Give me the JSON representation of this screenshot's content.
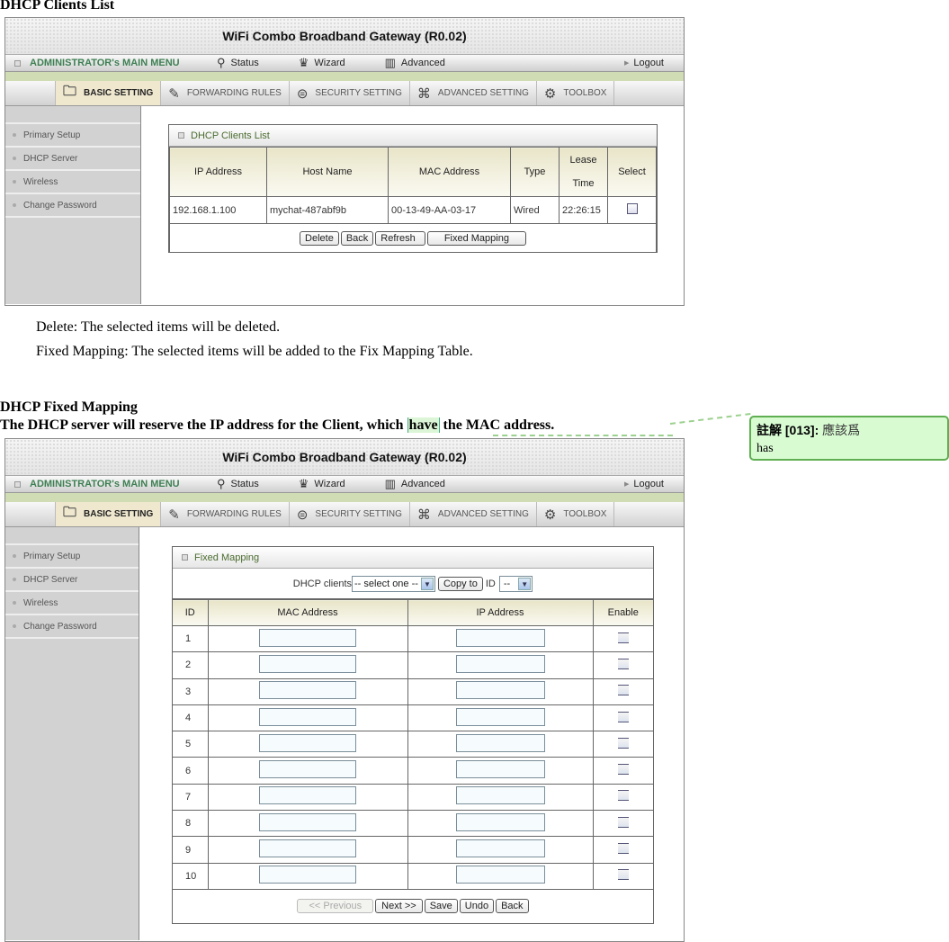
{
  "doc": {
    "heading1": "DHCP Clients List",
    "note_delete": "Delete: The selected items will be deleted.",
    "note_fixed": "Fixed Mapping: The selected items will be added to the Fix Mapping Table.",
    "heading2": "DHCP Fixed Mapping",
    "sentence_pre": "The DHCP server will reserve the IP address for the Client, which ",
    "sentence_highlight": "have",
    "sentence_post": " the MAC address."
  },
  "comment": {
    "label": "註解 [013]:",
    "suggestion_cjk": "應該爲",
    "body": "has",
    "border_color": "#5fae52",
    "bg_color": "#d8fbd2"
  },
  "router": {
    "title": "WiFi Combo Broadband Gateway (R0.02)",
    "admin_menu": "ADMINISTRATOR's MAIN MENU",
    "menu": [
      {
        "label": "Status",
        "icon": "status-icon",
        "glyph": "⚲"
      },
      {
        "label": "Wizard",
        "icon": "wizard-icon",
        "glyph": "♛"
      },
      {
        "label": "Advanced",
        "icon": "advanced-icon",
        "glyph": "▥"
      }
    ],
    "logout": "Logout",
    "tabs": [
      {
        "label": "BASIC SETTING",
        "icon": "folder-icon",
        "glyph": "🗀",
        "active": true
      },
      {
        "label": "FORWARDING RULES",
        "icon": "forwarding-icon",
        "glyph": "✎",
        "active": false
      },
      {
        "label": "SECURITY SETTING",
        "icon": "security-icon",
        "glyph": "⊜",
        "active": false
      },
      {
        "label": "ADVANCED SETTING",
        "icon": "advanced-setting-icon",
        "glyph": "⌘",
        "active": false
      },
      {
        "label": "TOOLBOX",
        "icon": "toolbox-icon",
        "glyph": "⚙",
        "active": false
      }
    ],
    "sidebar": [
      "Primary Setup",
      "DHCP Server",
      "Wireless",
      "Change Password"
    ],
    "accent_green": "#3d7f52"
  },
  "clients_panel": {
    "title": "DHCP Clients List",
    "headers": [
      "IP Address",
      "Host Name",
      "MAC Address",
      "Type",
      "Lease Time",
      "Select"
    ],
    "rows": [
      {
        "ip": "192.168.1.100",
        "host": "mychat-487abf9b",
        "mac": "00-13-49-AA-03-17",
        "type": "Wired",
        "lease": "22:26:15",
        "selected": false
      }
    ],
    "buttons": [
      "Delete",
      "Back",
      "Refresh",
      "Fixed Mapping"
    ]
  },
  "fixed_panel": {
    "title": "Fixed Mapping",
    "dhcp_clients_label": "DHCP clients",
    "dhcp_clients_value": "-- select one --",
    "copy_to_label": "Copy to",
    "id_label": "ID",
    "id_value": "--",
    "headers": [
      "ID",
      "MAC Address",
      "IP Address",
      "Enable"
    ],
    "rows": [
      {
        "id": "1",
        "mac": "",
        "ip": "",
        "enabled": false
      },
      {
        "id": "2",
        "mac": "",
        "ip": "",
        "enabled": false
      },
      {
        "id": "3",
        "mac": "",
        "ip": "",
        "enabled": false
      },
      {
        "id": "4",
        "mac": "",
        "ip": "",
        "enabled": false
      },
      {
        "id": "5",
        "mac": "",
        "ip": "",
        "enabled": false
      },
      {
        "id": "6",
        "mac": "",
        "ip": "",
        "enabled": false
      },
      {
        "id": "7",
        "mac": "",
        "ip": "",
        "enabled": false
      },
      {
        "id": "8",
        "mac": "",
        "ip": "",
        "enabled": false
      },
      {
        "id": "9",
        "mac": "",
        "ip": "",
        "enabled": false
      },
      {
        "id": "10",
        "mac": "",
        "ip": "",
        "enabled": false
      }
    ],
    "buttons": {
      "previous": "<< Previous",
      "next": "Next >>",
      "save": "Save",
      "undo": "Undo",
      "back": "Back"
    }
  }
}
